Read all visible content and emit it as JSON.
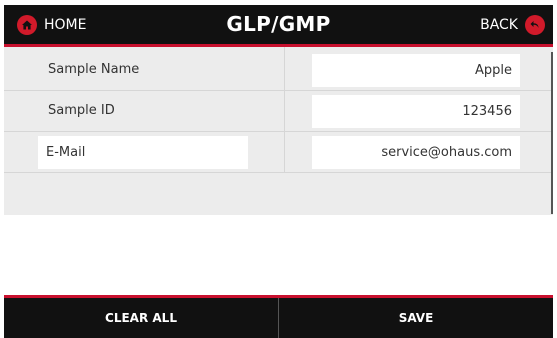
{
  "colors": {
    "header_bg": "#111111",
    "accent_red": "#c8102e",
    "content_bg": "#ececec",
    "field_bg": "#ffffff"
  },
  "header": {
    "home_label": "HOME",
    "home_icon": "home-icon",
    "title": "GLP/GMP",
    "back_label": "BACK",
    "back_icon": "back-arrow-icon"
  },
  "fields": [
    {
      "label": "Sample Name",
      "value": "Apple"
    },
    {
      "label": "Sample ID",
      "value": "123456"
    },
    {
      "label": "E-Mail",
      "value": "service@ohaus.com"
    }
  ],
  "footer": {
    "clear_all_label": "CLEAR ALL",
    "save_label": "SAVE"
  }
}
